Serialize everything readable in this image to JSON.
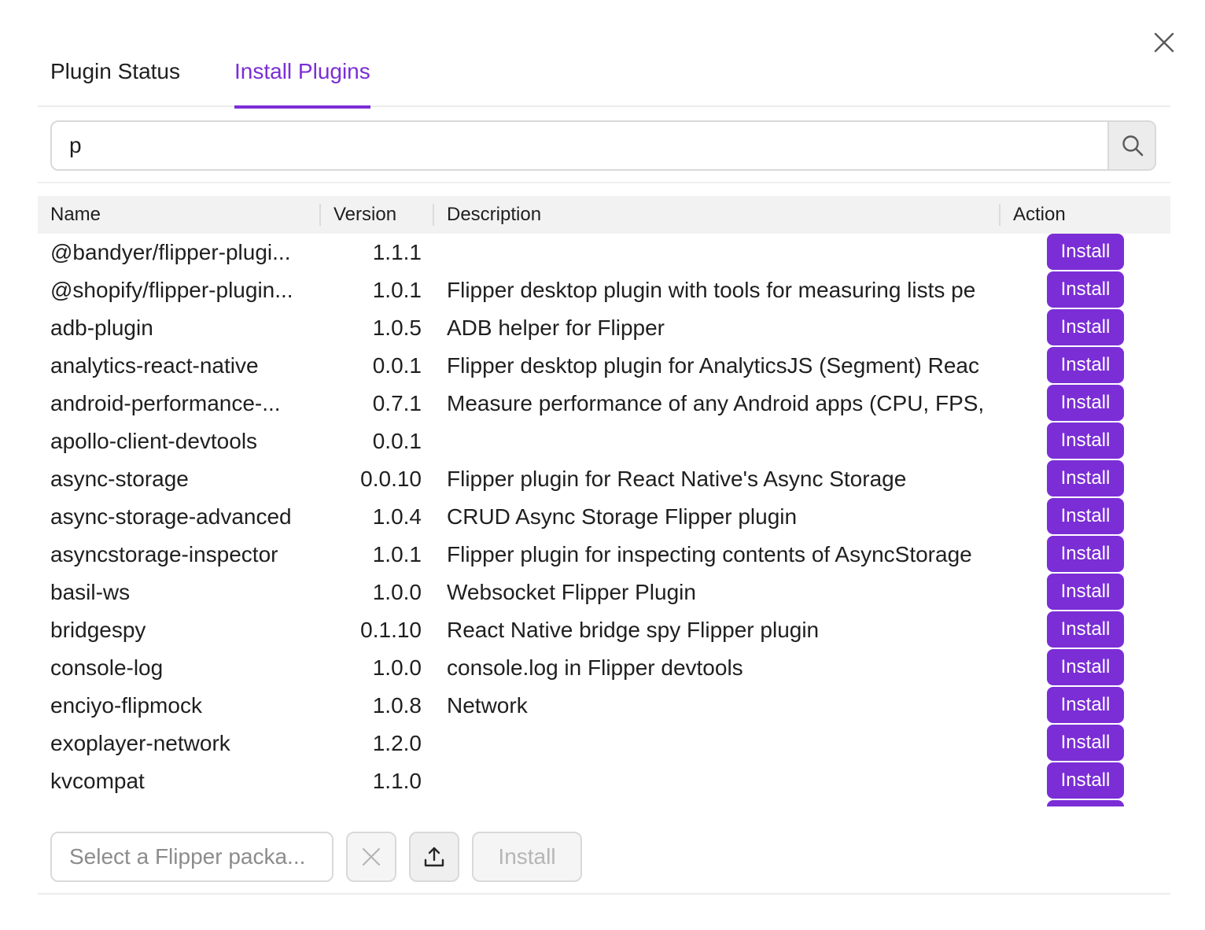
{
  "tabs": {
    "plugin_status": "Plugin Status",
    "install_plugins": "Install Plugins",
    "active": "install_plugins"
  },
  "search": {
    "value": "p",
    "icon": "search-icon"
  },
  "table": {
    "headers": {
      "name": "Name",
      "version": "Version",
      "description": "Description",
      "action": "Action"
    },
    "install_label": "Install",
    "rows": [
      {
        "name": "@bandyer/flipper-plugi...",
        "version": "1.1.1",
        "description": ""
      },
      {
        "name": "@shopify/flipper-plugin...",
        "version": "1.0.1",
        "description": "Flipper desktop plugin with tools for measuring lists pe"
      },
      {
        "name": "adb-plugin",
        "version": "1.0.5",
        "description": "ADB helper for Flipper"
      },
      {
        "name": "analytics-react-native",
        "version": "0.0.1",
        "description": "Flipper desktop plugin for AnalyticsJS (Segment) Reac"
      },
      {
        "name": "android-performance-...",
        "version": "0.7.1",
        "description": "Measure performance of any Android apps (CPU, FPS,"
      },
      {
        "name": "apollo-client-devtools",
        "version": "0.0.1",
        "description": ""
      },
      {
        "name": "async-storage",
        "version": "0.0.10",
        "description": "Flipper plugin for React Native's Async Storage"
      },
      {
        "name": "async-storage-advanced",
        "version": "1.0.4",
        "description": "CRUD Async Storage Flipper plugin"
      },
      {
        "name": "asyncstorage-inspector",
        "version": "1.0.1",
        "description": "Flipper plugin for inspecting contents of AsyncStorage"
      },
      {
        "name": "basil-ws",
        "version": "1.0.0",
        "description": "Websocket Flipper Plugin"
      },
      {
        "name": "bridgespy",
        "version": "0.1.10",
        "description": "React Native bridge spy Flipper plugin"
      },
      {
        "name": "console-log",
        "version": "1.0.0",
        "description": "console.log in Flipper devtools"
      },
      {
        "name": "enciyo-flipmock",
        "version": "1.0.8",
        "description": "Network"
      },
      {
        "name": "exoplayer-network",
        "version": "1.2.0",
        "description": ""
      },
      {
        "name": "kvcompat",
        "version": "1.1.0",
        "description": ""
      },
      {
        "name": "",
        "version": "",
        "description": ""
      }
    ]
  },
  "footer": {
    "package_placeholder": "Select a Flipper packa...",
    "install_label": "Install"
  },
  "colors": {
    "accent": "#7b2ed6"
  }
}
